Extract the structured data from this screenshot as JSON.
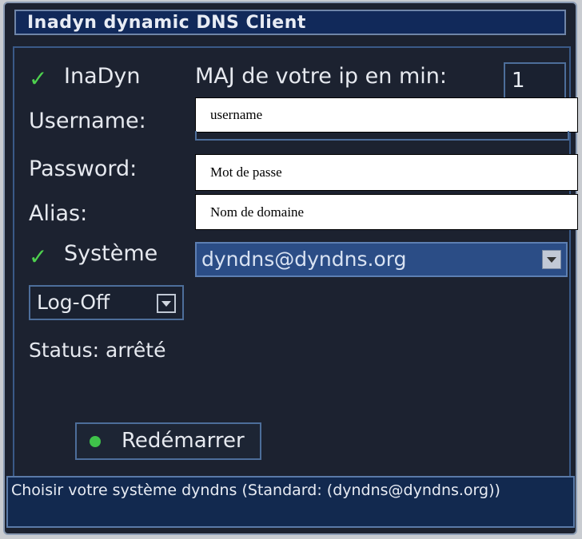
{
  "window": {
    "title": "Inadyn dynamic DNS Client"
  },
  "inadyn": {
    "label": "InaDyn",
    "checked": true
  },
  "update_interval": {
    "label": "MAJ de votre ip en min:",
    "value": "1"
  },
  "username": {
    "label": "Username:",
    "placeholder": "username"
  },
  "password": {
    "label": "Password:",
    "placeholder": "Mot de passe"
  },
  "alias": {
    "label": "Alias:",
    "placeholder": "Nom de domaine"
  },
  "system": {
    "label": "Système",
    "checked": true,
    "selected": "dyndns@dyndns.org"
  },
  "log": {
    "selected": "Log-Off"
  },
  "status": {
    "text": "Status: arrêté"
  },
  "restart": {
    "label": "Redémarrer"
  },
  "help": {
    "text": "Choisir votre système dyndns (Standard: (dyndns@dyndns.org))"
  },
  "colors": {
    "accent": "#2b4d86",
    "background": "#1c2230",
    "status_green": "#3fc24a"
  }
}
